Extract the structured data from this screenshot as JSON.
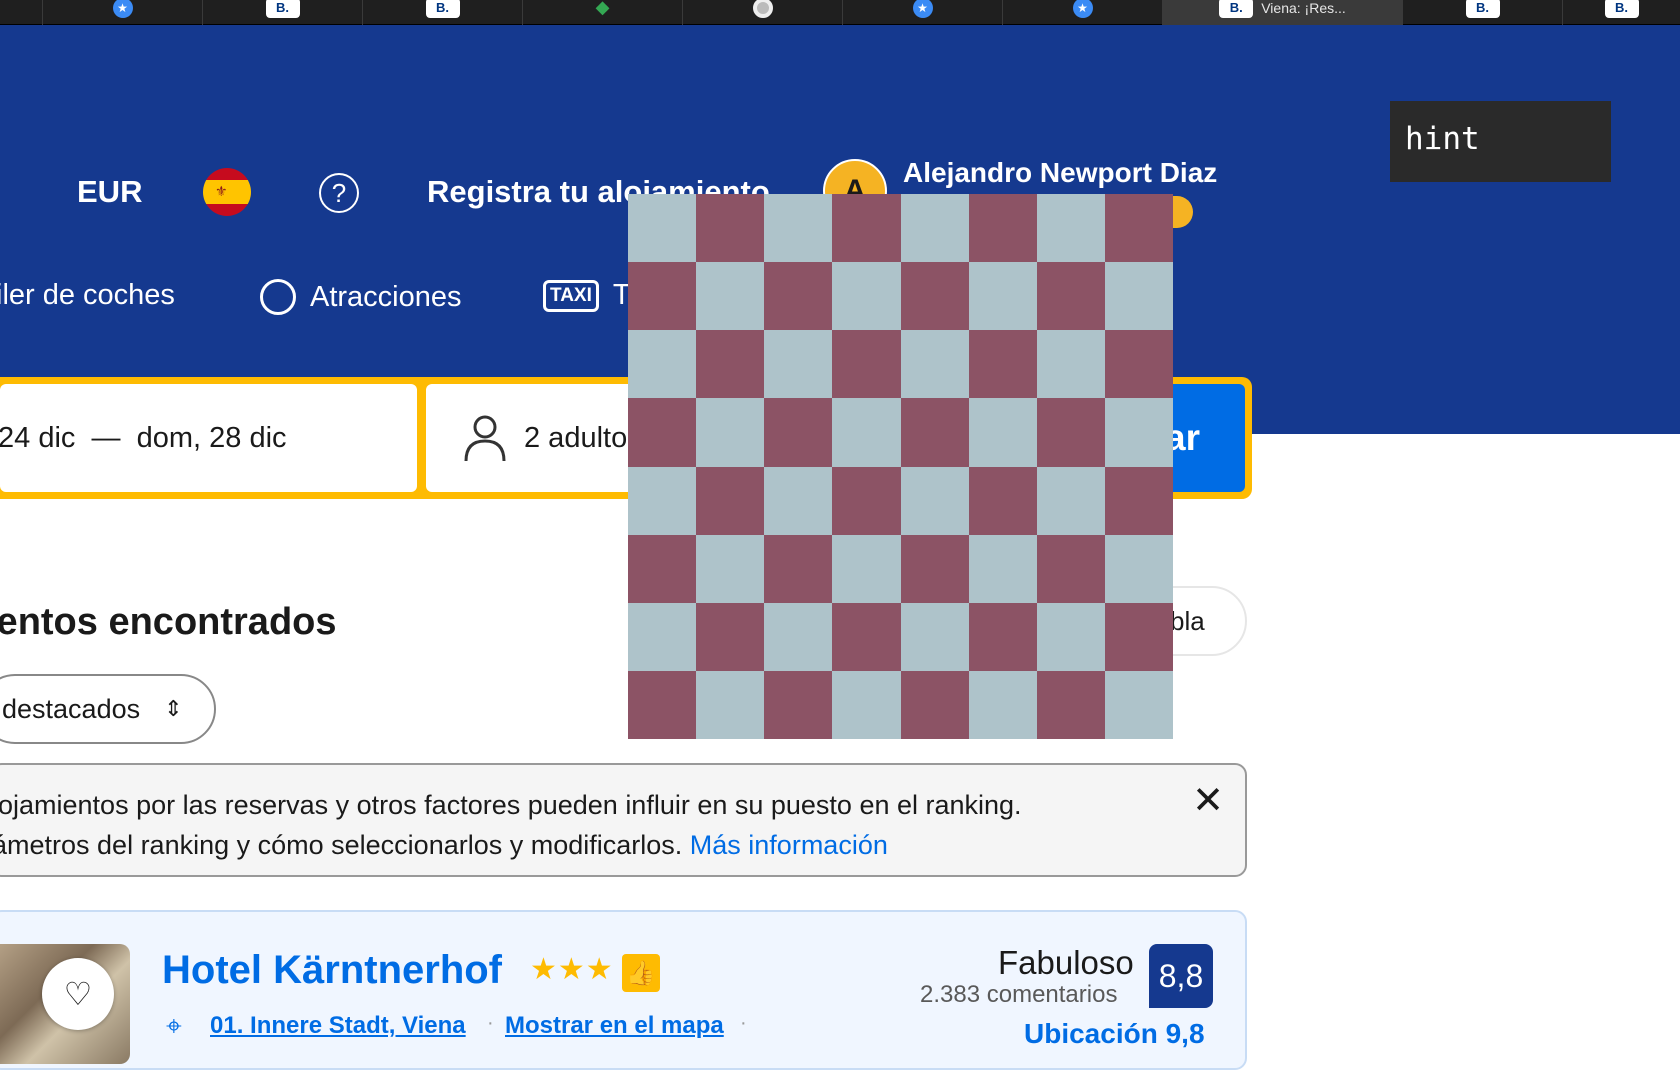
{
  "browser": {
    "tabs": [
      {
        "favicon": "star-icon",
        "label": ""
      },
      {
        "favicon": "booking-icon",
        "label": ""
      },
      {
        "favicon": "booking-icon",
        "label": ""
      },
      {
        "favicon": "maps-icon",
        "label": ""
      },
      {
        "favicon": "circle-icon",
        "label": ""
      },
      {
        "favicon": "star-icon",
        "label": ""
      },
      {
        "favicon": "star-icon",
        "label": ""
      },
      {
        "favicon": "booking-icon",
        "label": "Viena: ¡Res..."
      },
      {
        "favicon": "booking-icon",
        "label": ""
      },
      {
        "favicon": "booking-icon",
        "label": ""
      }
    ],
    "booking_favicon_text": "B."
  },
  "header": {
    "currency": "EUR",
    "register_property": "Registra tu alojamiento",
    "user_name": "Alejandro Newport Diaz",
    "avatar_initial": "A",
    "genius_badge": "s"
  },
  "nav": {
    "items": [
      "iler de coches",
      "Atracciones",
      "Ta"
    ],
    "taxi_icon_text": "TAXI"
  },
  "search": {
    "dates": "24 dic  —  dom, 28 dic",
    "guests": "2 adulto",
    "button": "ar"
  },
  "results": {
    "title": "ientos encontrados",
    "sort_label": "destacados",
    "map_toggle": "bla"
  },
  "notice": {
    "line1": "lojamientos por las reservas y otros factores pueden influir en su puesto en el ranking.",
    "line2": "ámetros del ranking y cómo seleccionarlos y modificarlos. ",
    "more_link": "Más información"
  },
  "hotel": {
    "name": "Hotel Kärntnerhof",
    "stars": "★★★",
    "district": "01. Innere Stadt, Viena",
    "map_link": "Mostrar en el mapa",
    "rating_word": "Fabuloso",
    "reviews": "2.383 comentarios",
    "score": "8,8",
    "location_score": "Ubicación 9,8"
  },
  "overlay": {
    "hint": "hint"
  },
  "colors": {
    "brand_blue": "#15398f",
    "accent_yellow": "#febb02",
    "link_blue": "#006ce4",
    "checker_light": "#aec3ca",
    "checker_dark": "#8c5365"
  }
}
